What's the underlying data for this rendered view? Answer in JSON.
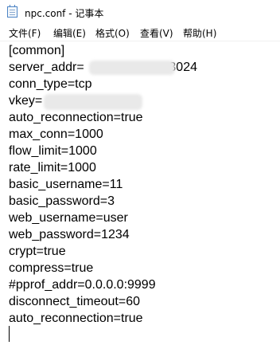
{
  "window": {
    "title": "npc.conf - 记事本"
  },
  "menu": [
    {
      "label": "文件(F)"
    },
    {
      "label": "编辑(E)"
    },
    {
      "label": "格式(O)"
    },
    {
      "label": "查看(V)"
    },
    {
      "label": "帮助(H)"
    }
  ],
  "editor": {
    "lines": [
      "[common]",
      "server_addr=                        3024",
      "conn_type=tcp",
      "vkey=",
      "auto_reconnection=true",
      "max_conn=1000",
      "flow_limit=1000",
      "rate_limit=1000",
      "basic_username=11",
      "basic_password=3",
      "web_username=user",
      "web_password=1234",
      "crypt=true",
      "compress=true",
      "#pprof_addr=0.0.0.0:9999",
      "disconnect_timeout=60",
      "auto_reconnection=true"
    ]
  },
  "colors": {
    "background": "#ffffff",
    "text": "#000000",
    "redaction": "#e9e9e9"
  },
  "icons": {
    "app": "notepad-icon"
  }
}
